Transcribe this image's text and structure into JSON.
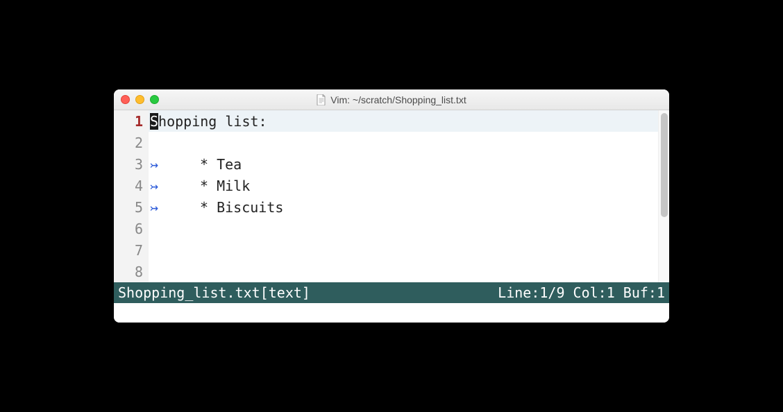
{
  "window": {
    "title": "Vim: ~/scratch/Shopping_list.txt"
  },
  "editor": {
    "cursor_line": 1,
    "cursor_col": 1,
    "lines": [
      {
        "num": "1",
        "cursor_char": "S",
        "rest": "hopping list:",
        "indented": false,
        "current": true
      },
      {
        "num": "2",
        "text": "",
        "indented": false
      },
      {
        "num": "3",
        "text": "* Tea",
        "indented": true
      },
      {
        "num": "4",
        "text": "* Milk",
        "indented": true
      },
      {
        "num": "5",
        "text": "* Biscuits",
        "indented": true
      },
      {
        "num": "6",
        "text": "",
        "indented": false
      },
      {
        "num": "7",
        "text": "",
        "indented": false
      },
      {
        "num": "8",
        "text": "",
        "indented": false
      }
    ]
  },
  "status": {
    "left": "Shopping_list.txt[text]",
    "right": "Line:1/9 Col:1 Buf:1"
  }
}
